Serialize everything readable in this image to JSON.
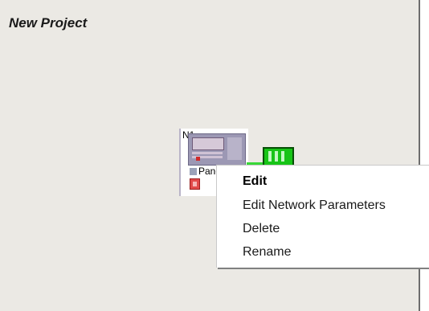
{
  "project": {
    "title": "New Project"
  },
  "node": {
    "id": "N1",
    "label": "Panel..."
  },
  "context_menu": {
    "items": [
      {
        "label": "Edit",
        "default": true
      },
      {
        "label": "Edit Network Parameters",
        "default": false
      },
      {
        "label": "Delete",
        "default": false
      },
      {
        "label": "Rename",
        "default": false
      }
    ]
  },
  "colors": {
    "canvas_bg": "#ebe9e4",
    "device_green": "#17c417",
    "link_green": "#38d838",
    "alarm_red": "#e24a4a"
  },
  "icons": {
    "node_panel": "fire-panel-icon",
    "node_alarm": "alarm-device-icon",
    "link_device": "network-module-icon"
  }
}
